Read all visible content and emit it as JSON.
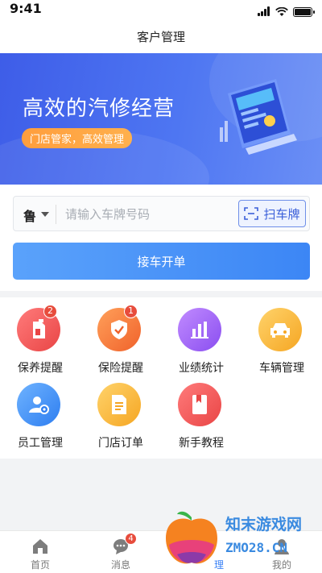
{
  "status_bar": {
    "time": "9:41"
  },
  "nav": {
    "title": "客户管理"
  },
  "banner": {
    "title": "高效的汽修经营",
    "subtitle": "门店管家，高效管理"
  },
  "search": {
    "province": "鲁",
    "placeholder": "请输入车牌号码",
    "scan_label": "扫车牌",
    "submit_label": "接车开单"
  },
  "grid": {
    "items": [
      {
        "label": "保养提醒",
        "icon": "maintenance-icon",
        "badge": "2",
        "color": "#ef5454"
      },
      {
        "label": "保险提醒",
        "icon": "insurance-icon",
        "badge": "1",
        "color": "#f27a3a"
      },
      {
        "label": "业绩统计",
        "icon": "statistics-icon",
        "badge": "",
        "color": "#9b59f0"
      },
      {
        "label": "车辆管理",
        "icon": "car-icon",
        "badge": "",
        "color": "#f6b93b"
      },
      {
        "label": "员工管理",
        "icon": "employee-icon",
        "badge": "",
        "color": "#3d8ef0"
      },
      {
        "label": "门店订单",
        "icon": "order-icon",
        "badge": "",
        "color": "#f6b93b"
      },
      {
        "label": "新手教程",
        "icon": "tutorial-icon",
        "badge": "",
        "color": "#ef5454"
      }
    ]
  },
  "tabbar": {
    "items": [
      {
        "label": "首页",
        "icon": "home-icon",
        "badge": ""
      },
      {
        "label": "消息",
        "icon": "message-icon",
        "badge": "4"
      },
      {
        "label": "理",
        "icon": "manage-icon",
        "badge": ""
      },
      {
        "label": "我的",
        "icon": "profile-icon",
        "badge": ""
      }
    ]
  },
  "watermark": {
    "line1": "知末游戏网",
    "line2": "ZMO28.CN"
  }
}
